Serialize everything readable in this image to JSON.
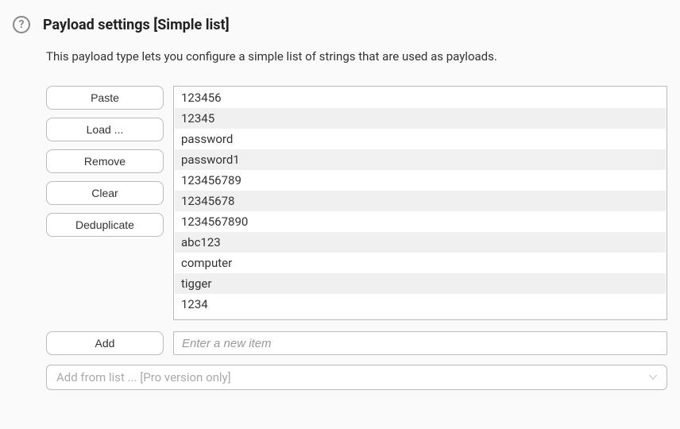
{
  "header": {
    "title": "Payload settings [Simple list]",
    "help_symbol": "?"
  },
  "description": "This payload type lets you configure a simple list of strings that are used as payloads.",
  "buttons": {
    "paste": "Paste",
    "load": "Load ...",
    "remove": "Remove",
    "clear": "Clear",
    "deduplicate": "Deduplicate",
    "add": "Add"
  },
  "payload_list": [
    "123456",
    "12345",
    "password",
    "password1",
    "123456789",
    "12345678",
    "1234567890",
    "abc123",
    "computer",
    "tigger",
    "1234"
  ],
  "add_input": {
    "placeholder": "Enter a new item",
    "value": ""
  },
  "dropdown": {
    "label": "Add from list ... [Pro version only]"
  }
}
